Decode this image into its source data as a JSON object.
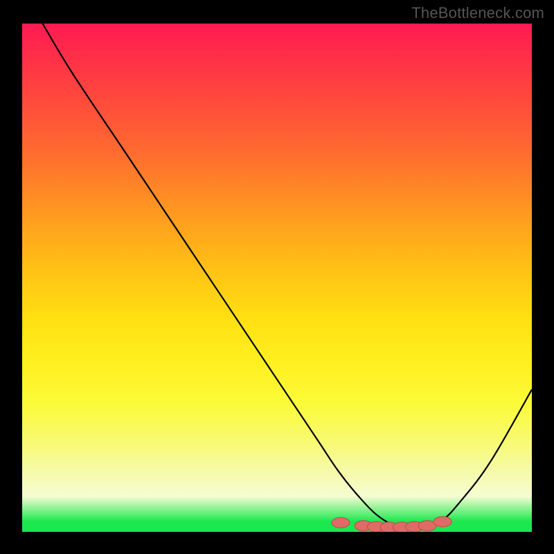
{
  "watermark": "TheBottleneck.com",
  "chart_data": {
    "type": "line",
    "title": "",
    "xlabel": "",
    "ylabel": "",
    "xlim": [
      0,
      100
    ],
    "ylim": [
      0,
      100
    ],
    "grid": false,
    "legend": false,
    "series": [
      {
        "name": "curve",
        "x": [
          4,
          10,
          20,
          30,
          40,
          50,
          58,
          62,
          66,
          70,
          74,
          78,
          82,
          86,
          92,
          100
        ],
        "y": [
          100,
          90,
          75,
          60,
          45,
          30,
          18,
          12,
          7,
          3,
          1,
          1,
          2,
          6,
          14,
          28
        ]
      }
    ],
    "markers": {
      "name": "optimal-range",
      "shape": "rounded-capsule",
      "color": "#e06a66",
      "points": [
        {
          "x": 62.5,
          "y": 1.8
        },
        {
          "x": 67.0,
          "y": 1.2
        },
        {
          "x": 69.5,
          "y": 1.0
        },
        {
          "x": 72.0,
          "y": 0.9
        },
        {
          "x": 74.5,
          "y": 0.9
        },
        {
          "x": 77.0,
          "y": 1.0
        },
        {
          "x": 79.5,
          "y": 1.2
        },
        {
          "x": 82.5,
          "y": 2.0
        }
      ]
    },
    "background_gradient": {
      "top": "#ff1a52",
      "mid": "#ffe012",
      "bottom": "#1be84e"
    }
  }
}
